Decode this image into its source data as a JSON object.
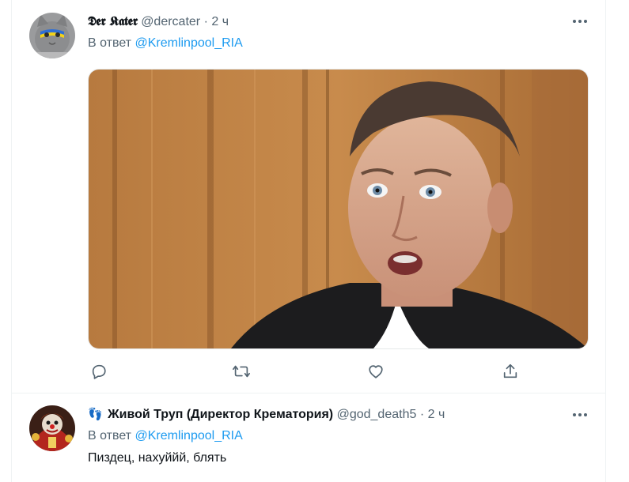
{
  "tweets": [
    {
      "name": "𝕯𝖊𝖗 𝕶𝖆𝖙𝖊𝖗",
      "handle": "@dercater",
      "dot": "·",
      "time": "2 ч",
      "reply_prefix": "В ответ",
      "reply_mention": "@Kremlinpool_RIA",
      "avatar_icon": "cat-avatar",
      "media_icon": "photo-man-in-front-of-wooden-wall",
      "actions": [
        "reply-icon",
        "retweet-icon",
        "like-icon",
        "share-icon"
      ]
    },
    {
      "name_emoji": "👣",
      "name": "Живой Труп (Директор Крематория)",
      "handle": "@god_death5",
      "dot": "·",
      "time": "2 ч",
      "reply_prefix": "В ответ",
      "reply_mention": "@Kremlinpool_RIA",
      "text": "Пиздец, нахуййй, блять",
      "avatar_icon": "clown-avatar"
    }
  ],
  "colors": {
    "accent": "#1d9bf0",
    "secondary_text": "#536471",
    "primary_text": "#0f1419",
    "divider": "#eff3f4"
  }
}
